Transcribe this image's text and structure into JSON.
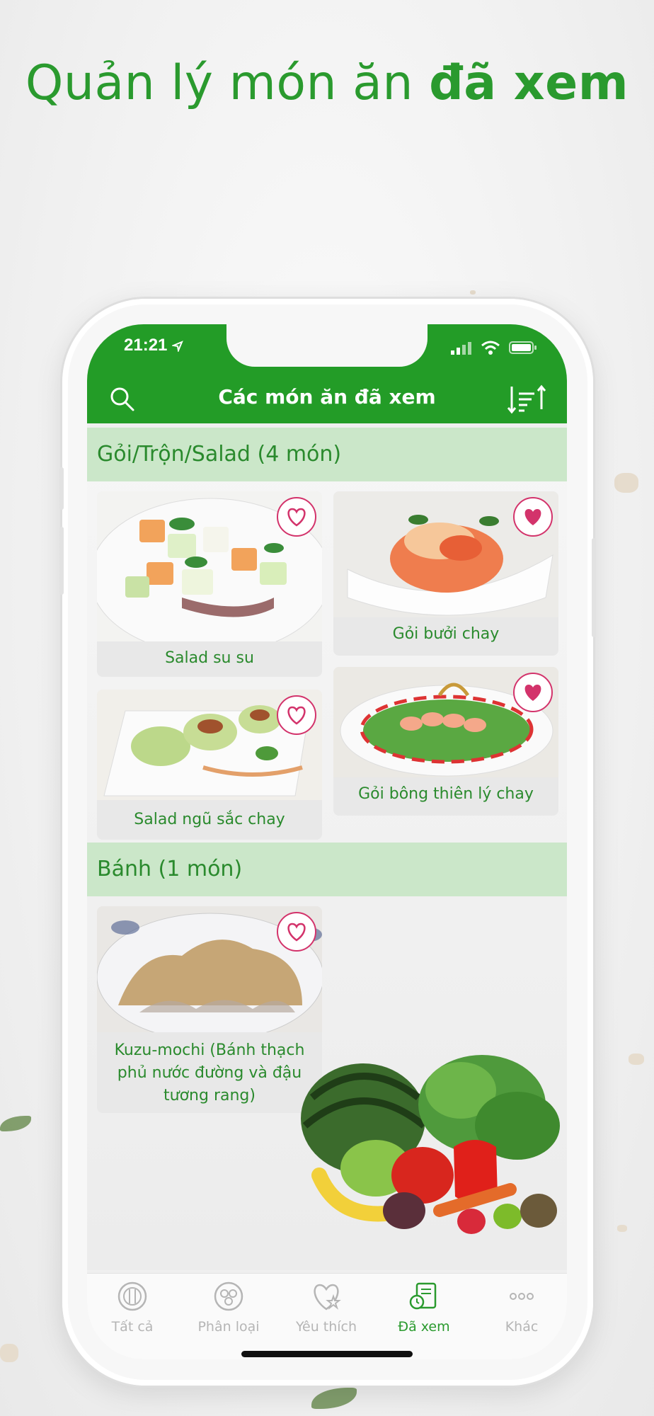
{
  "headline": {
    "regular": "Quản lý món ăn",
    "bold": "đã xem"
  },
  "status_bar": {
    "time": "21:21"
  },
  "nav": {
    "title": "Các món ăn đã xem",
    "search_icon": "search-icon",
    "sort_icon": "sort-icon"
  },
  "sections": [
    {
      "title": "Gỏi/Trộn/Salad (4 món)",
      "items": [
        {
          "name": "Salad su su",
          "favorite": false
        },
        {
          "name": "Gỏi bưởi chay",
          "favorite": true
        },
        {
          "name": "Salad ngũ sắc chay",
          "favorite": false
        },
        {
          "name": "Gỏi bông thiên lý chay",
          "favorite": true
        }
      ]
    },
    {
      "title": "Bánh (1 món)",
      "items": [
        {
          "name": "Kuzu-mochi (Bánh thạch phủ nước đường và đậu tương rang)",
          "favorite": false
        }
      ]
    }
  ],
  "tabs": [
    {
      "label": "Tất cả",
      "icon": "plate-icon",
      "active": false
    },
    {
      "label": "Phân loại",
      "icon": "categories-icon",
      "active": false
    },
    {
      "label": "Yêu thích",
      "icon": "heart-star-icon",
      "active": false
    },
    {
      "label": "Đã xem",
      "icon": "viewed-history-icon",
      "active": true
    },
    {
      "label": "Khác",
      "icon": "more-icon",
      "active": false
    }
  ],
  "colors": {
    "brand_green": "#239c27",
    "section_bg": "#cbe7c9",
    "heart_pink": "#d3336b"
  }
}
